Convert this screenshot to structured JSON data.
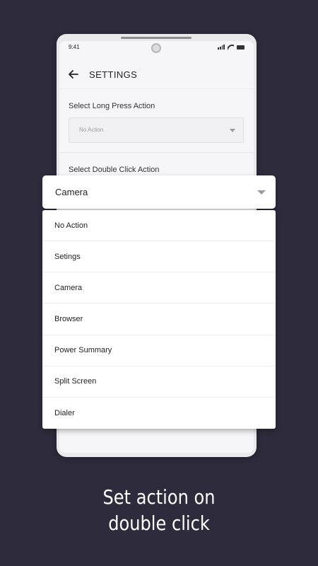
{
  "status_bar": {
    "time": "9:41"
  },
  "app_bar": {
    "title": "SETTINGS"
  },
  "settings": {
    "long_press_label": "Select Long Press Action",
    "long_press_value": "No Action",
    "double_click_label": "Select Double Click Action"
  },
  "dropdown": {
    "selected": "Camera",
    "options": [
      "No Action",
      "Setings",
      "Camera",
      "Browser",
      "Power Summary",
      "Split Screen",
      "Dialer"
    ]
  },
  "caption": {
    "line1": "Set action on",
    "line2": "double click"
  },
  "colors": {
    "background": "#2e2c3c",
    "surface": "#ffffff",
    "screen": "#f6f6f8"
  },
  "icons": {
    "back": "arrow-left-icon",
    "caret": "caret-down-icon"
  }
}
